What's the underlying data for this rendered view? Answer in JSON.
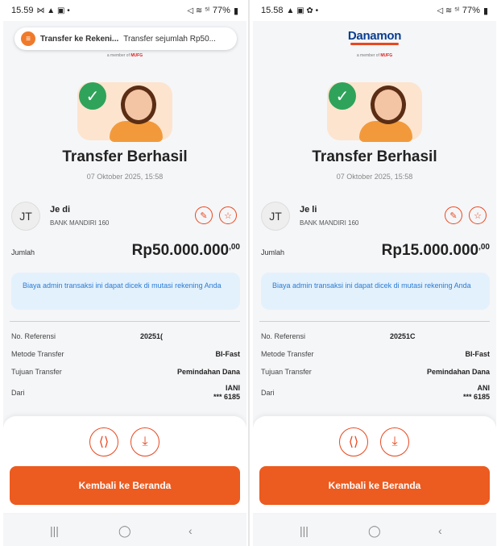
{
  "screens": [
    {
      "status": {
        "time": "15.59",
        "left_icons": "⋈ ▲ ▣ •",
        "right_icons": "◁ ≋ ⁵ᴵ",
        "battery": "77%"
      },
      "notification": {
        "title": "Transfer ke Rekeni...",
        "text": "Transfer sejumlah Rp50..."
      },
      "brand": {
        "name": "",
        "tagline_prefix": "a member of",
        "tagline_brand": "MUFG"
      },
      "title": "Transfer Berhasil",
      "datetime": "07 Oktober 2025, 15:58",
      "recipient": {
        "initials": "JT",
        "name": "Je                    di",
        "bank": "BANK MANDIRI 160"
      },
      "amount": {
        "label": "Jumlah",
        "value": "Rp50.000.000",
        "decimals": ",00"
      },
      "info": "Biaya admin transaksi ini dapat dicek di mutasi rekening Anda",
      "details": {
        "ref_label": "No. Referensi",
        "ref_value": "20251(",
        "method_label": "Metode Transfer",
        "method_value": "BI-Fast",
        "purpose_label": "Tujuan Transfer",
        "purpose_value": "Pemindahan Dana",
        "from_label": "Dari",
        "from_line1": "IANI",
        "from_line2": "*** 6185"
      },
      "button": "Kembali ke Beranda"
    },
    {
      "status": {
        "time": "15.58",
        "left_icons": "▲ ▣ ✿ •",
        "right_icons": "◁ ≋ ⁵ᴵ",
        "battery": "77%"
      },
      "notification": {
        "title": "",
        "text": ""
      },
      "brand": {
        "name": "Danamon",
        "tagline_prefix": "a member of",
        "tagline_brand": "MUFG"
      },
      "title": "Transfer Berhasil",
      "datetime": "07 Oktober 2025, 15:58",
      "recipient": {
        "initials": "JT",
        "name": "Je                 li",
        "bank": "BANK MANDIRI 160"
      },
      "amount": {
        "label": "Jumlah",
        "value": "Rp15.000.000",
        "decimals": ",00"
      },
      "info": "Biaya admin transaksi ini dapat dicek di mutasi rekening Anda",
      "details": {
        "ref_label": "No. Referensi",
        "ref_value": "20251C",
        "method_label": "Metode Transfer",
        "method_value": "BI-Fast",
        "purpose_label": "Tujuan Transfer",
        "purpose_value": "Pemindahan Dana",
        "from_label": "Dari",
        "from_line1": "ANI",
        "from_line2": "*** 6185"
      },
      "button": "Kembali ke Beranda"
    }
  ],
  "icons": {
    "share": "share-icon",
    "download": "download-icon",
    "star": "star-icon",
    "favorite": "favorite-icon"
  },
  "colors": {
    "accent": "#ec5b1f",
    "success": "#2fa35a",
    "info_bg": "#e3f1fc",
    "info_text": "#2a7bd4",
    "brand_blue": "#0a3d8f"
  }
}
